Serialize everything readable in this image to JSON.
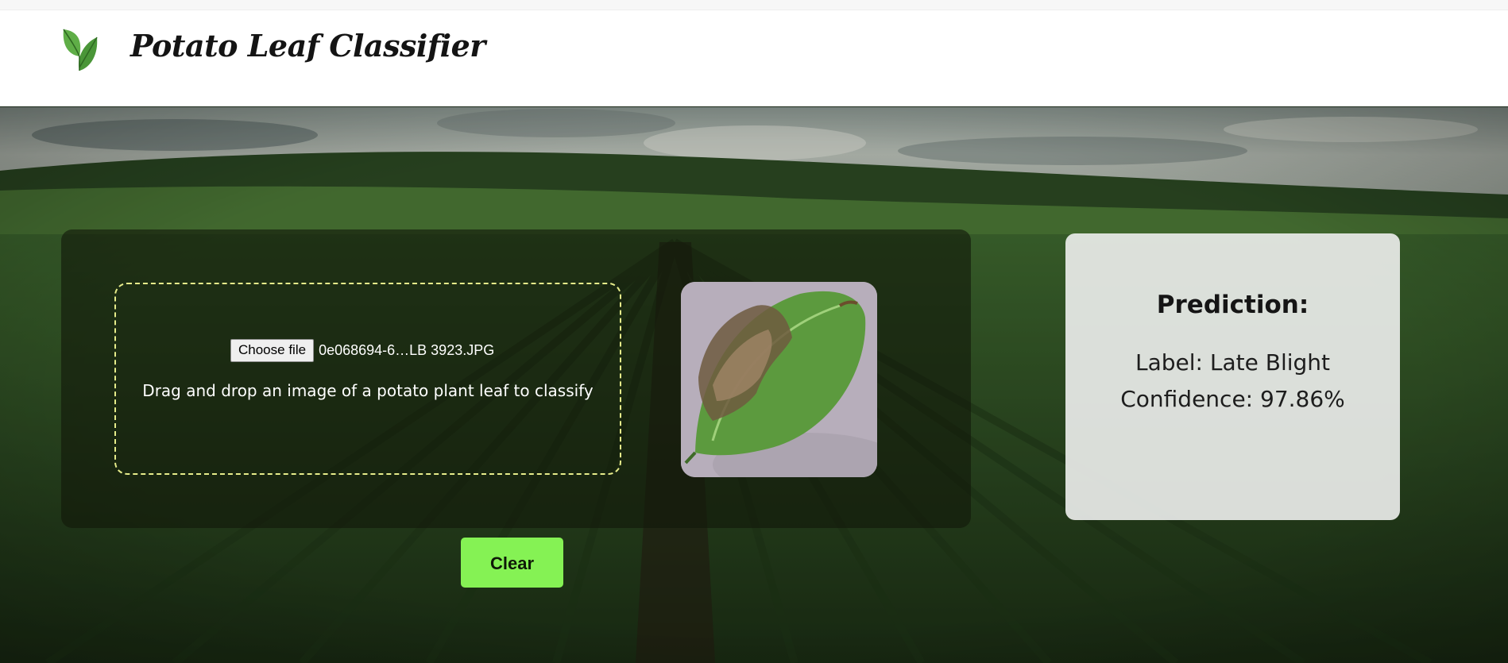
{
  "app": {
    "title": "Potato Leaf Classifier"
  },
  "upload": {
    "choose_file_label": "Choose file",
    "file_name": "0e068694-6…LB 3923.JPG",
    "hint": "Drag and drop an image of a potato plant leaf to classify"
  },
  "prediction": {
    "title": "Prediction:",
    "label_text": "Label: Late Blight",
    "confidence_text": "Confidence: 97.86%"
  },
  "actions": {
    "clear_label": "Clear"
  },
  "colors": {
    "accent_green": "#85f254",
    "dropzone_border": "#e6ec8a",
    "logo_leaf": "#4f9a3c"
  },
  "icons": {
    "logo": "leaf-icon"
  }
}
